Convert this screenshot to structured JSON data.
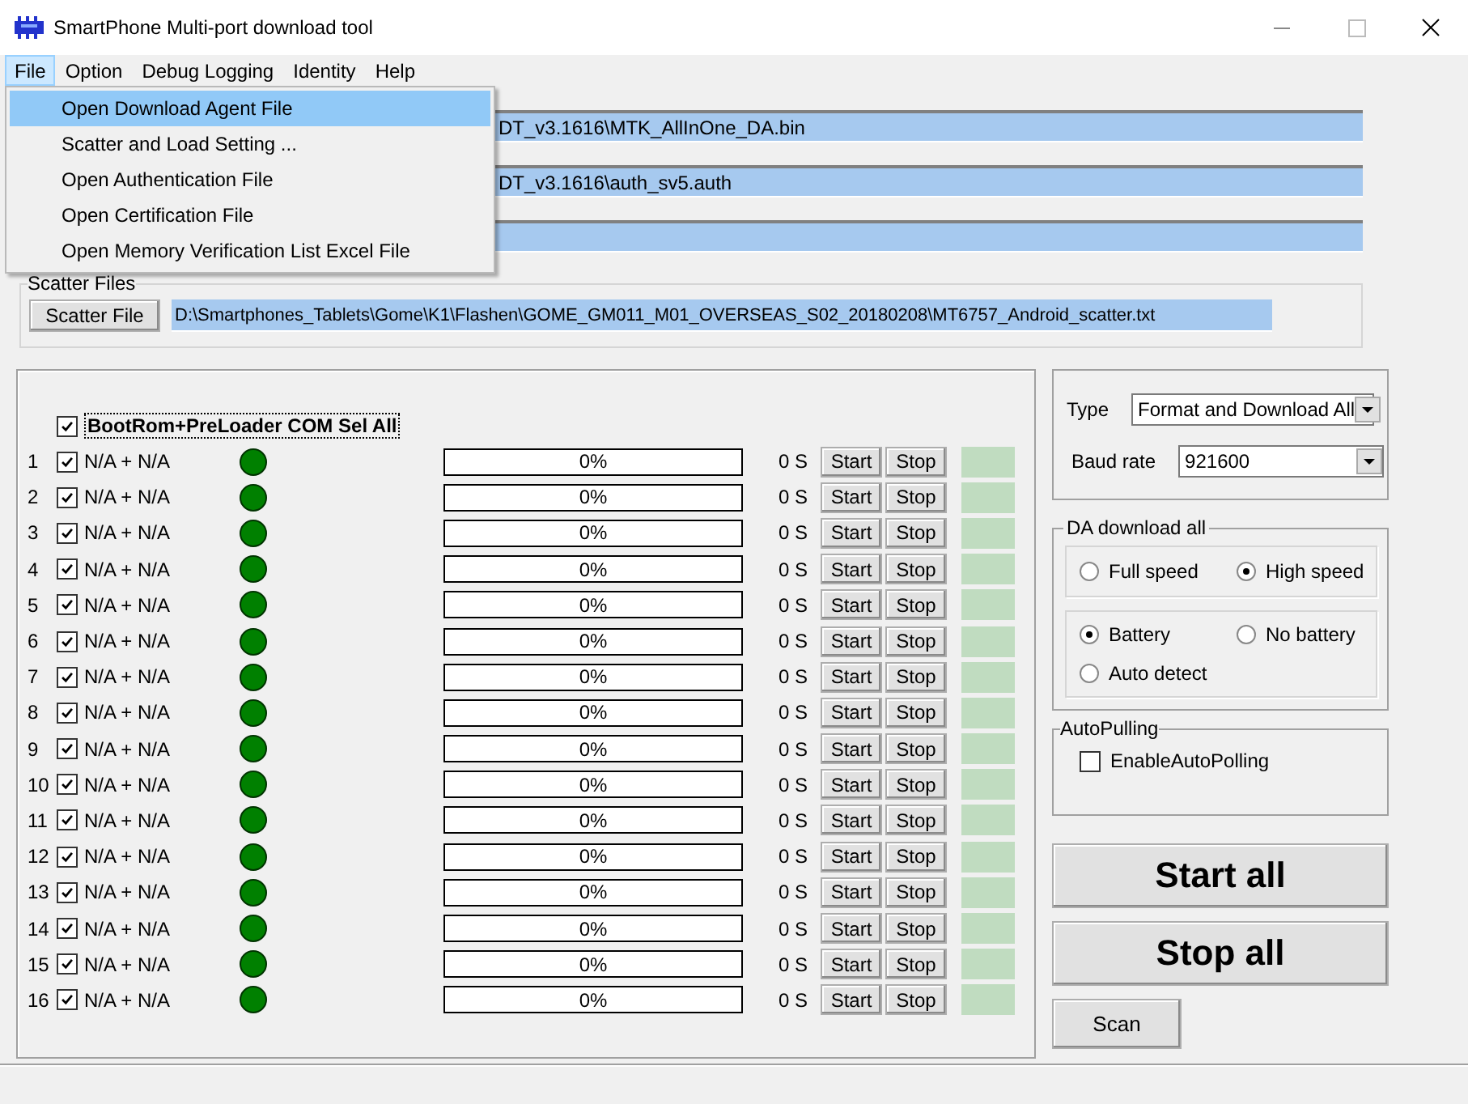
{
  "window": {
    "title": "SmartPhone Multi-port download tool"
  },
  "menu": [
    {
      "label": "File",
      "selected": true
    },
    {
      "label": "Option",
      "selected": false
    },
    {
      "label": "Debug Logging",
      "selected": false
    },
    {
      "label": "Identity",
      "selected": false
    },
    {
      "label": "Help",
      "selected": false
    }
  ],
  "file_menu": [
    {
      "label": "Open Download Agent File",
      "selected": true
    },
    {
      "label": "Scatter and Load Setting ...",
      "selected": false
    },
    {
      "label": "Open Authentication File",
      "selected": false
    },
    {
      "label": "Open Certification File",
      "selected": false
    },
    {
      "label": "Open Memory Verification List Excel File",
      "selected": false
    }
  ],
  "file_fields": [
    {
      "kind": "path",
      "value": "DT_v3.1616\\MTK_AllInOne_DA.bin"
    },
    {
      "kind": "path",
      "value": "DT_v3.1616\\auth_sv5.auth"
    },
    {
      "kind": "empty"
    }
  ],
  "scatter": {
    "title": "Scatter Files",
    "button": "Scatter File",
    "value": "D:\\Smartphones_Tablets\\Gome\\K1\\Flashen\\GOME_GM011_M01_OVERSEAS_S02_20180208\\MT6757_Android_scatter.txt"
  },
  "ports": {
    "select_all": {
      "label": "BootRom+PreLoader COM Sel All",
      "checked": true
    },
    "rows": [
      {
        "number": "1",
        "checked": true,
        "port": "N/A + N/A",
        "progress": "0%",
        "level": 0,
        "time": "0 S",
        "start": "Start",
        "stop": "Stop"
      },
      {
        "number": "2",
        "checked": true,
        "port": "N/A + N/A",
        "progress": "0%",
        "level": 0,
        "time": "0 S",
        "start": "Start",
        "stop": "Stop"
      },
      {
        "number": "3",
        "checked": true,
        "port": "N/A + N/A",
        "progress": "0%",
        "level": 0,
        "time": "0 S",
        "start": "Start",
        "stop": "Stop"
      },
      {
        "number": "4",
        "checked": true,
        "port": "N/A + N/A",
        "progress": "0%",
        "level": 0,
        "time": "0 S",
        "start": "Start",
        "stop": "Stop"
      },
      {
        "number": "5",
        "checked": true,
        "port": "N/A + N/A",
        "progress": "0%",
        "level": 0,
        "time": "0 S",
        "start": "Start",
        "stop": "Stop"
      },
      {
        "number": "6",
        "checked": true,
        "port": "N/A + N/A",
        "progress": "0%",
        "level": 0,
        "time": "0 S",
        "start": "Start",
        "stop": "Stop"
      },
      {
        "number": "7",
        "checked": true,
        "port": "N/A + N/A",
        "progress": "0%",
        "level": 0,
        "time": "0 S",
        "start": "Start",
        "stop": "Stop"
      },
      {
        "number": "8",
        "checked": true,
        "port": "N/A + N/A",
        "progress": "0%",
        "level": 0,
        "time": "0 S",
        "start": "Start",
        "stop": "Stop"
      },
      {
        "number": "9",
        "checked": true,
        "port": "N/A + N/A",
        "progress": "0%",
        "level": 0,
        "time": "0 S",
        "start": "Start",
        "stop": "Stop"
      },
      {
        "number": "10",
        "checked": true,
        "port": "N/A + N/A",
        "progress": "0%",
        "level": 0,
        "time": "0 S",
        "start": "Start",
        "stop": "Stop"
      },
      {
        "number": "11",
        "checked": true,
        "port": "N/A + N/A",
        "progress": "0%",
        "level": 0,
        "time": "0 S",
        "start": "Start",
        "stop": "Stop"
      },
      {
        "number": "12",
        "checked": true,
        "port": "N/A + N/A",
        "progress": "0%",
        "level": 0,
        "time": "0 S",
        "start": "Start",
        "stop": "Stop"
      },
      {
        "number": "13",
        "checked": true,
        "port": "N/A + N/A",
        "progress": "0%",
        "level": 0,
        "time": "0 S",
        "start": "Start",
        "stop": "Stop"
      },
      {
        "number": "14",
        "checked": true,
        "port": "N/A + N/A",
        "progress": "0%",
        "level": 0,
        "time": "0 S",
        "start": "Start",
        "stop": "Stop"
      },
      {
        "number": "15",
        "checked": true,
        "port": "N/A + N/A",
        "progress": "0%",
        "level": 0,
        "time": "0 S",
        "start": "Start",
        "stop": "Stop"
      },
      {
        "number": "16",
        "checked": true,
        "port": "N/A + N/A",
        "progress": "0%",
        "level": 0,
        "time": "0 S",
        "start": "Start",
        "stop": "Stop"
      }
    ]
  },
  "settings": {
    "type_label": "Type",
    "type_value": "Format and Download All",
    "baud_label": "Baud rate",
    "baud_value": "921600"
  },
  "da_download": {
    "title": "DA download all",
    "speed": [
      {
        "label": "Full speed",
        "selected": false
      },
      {
        "label": "High speed",
        "selected": true
      }
    ],
    "battery": [
      {
        "label": "Battery",
        "selected": true
      },
      {
        "label": "No battery",
        "selected": false
      },
      {
        "label": "Auto detect",
        "selected": false
      }
    ]
  },
  "auto_polling": {
    "title": "AutoPulling",
    "label": "EnableAutoPolling",
    "checked": false
  },
  "buttons": {
    "start_all": "Start all",
    "stop_all": "Stop all",
    "scan": "Scan"
  }
}
